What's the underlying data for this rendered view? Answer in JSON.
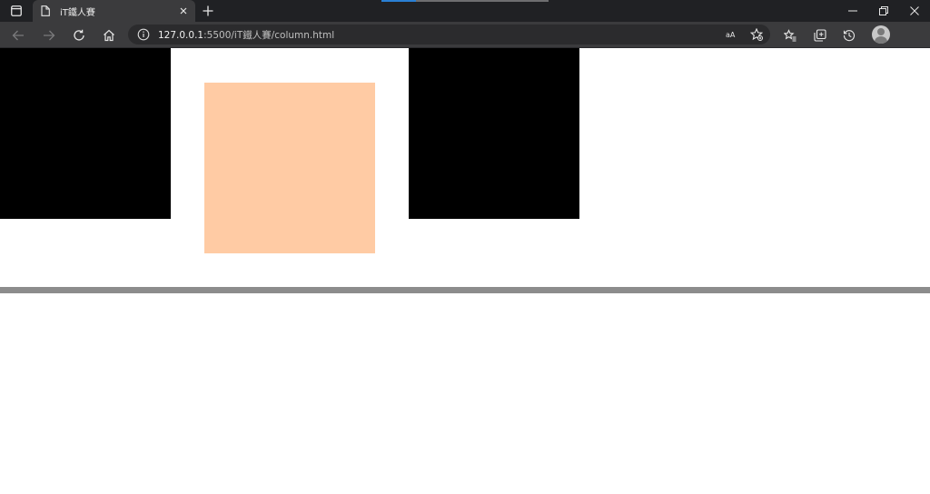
{
  "browser": {
    "tab": {
      "title": "iT鐵人賽",
      "favicon": "page-icon"
    },
    "address_bar": {
      "host": "127.0.0.1",
      "rest": ":5500/iT鐵人賽/column.html"
    },
    "toolbar_icons": [
      "back-icon",
      "forward-icon",
      "refresh-icon",
      "home-icon",
      "read-aloud-icon",
      "add-favorite-icon",
      "favorites-icon",
      "collections-icon",
      "history-icon",
      "profile-avatar"
    ],
    "window_controls": [
      "minimize-icon",
      "restore-icon",
      "close-icon"
    ]
  },
  "page": {
    "boxes": [
      {
        "name": "box-1",
        "color": "#000000"
      },
      {
        "name": "box-2",
        "color": "#ffcba4"
      },
      {
        "name": "box-3",
        "color": "#000000"
      }
    ],
    "divider_color": "#8c8c8c"
  }
}
